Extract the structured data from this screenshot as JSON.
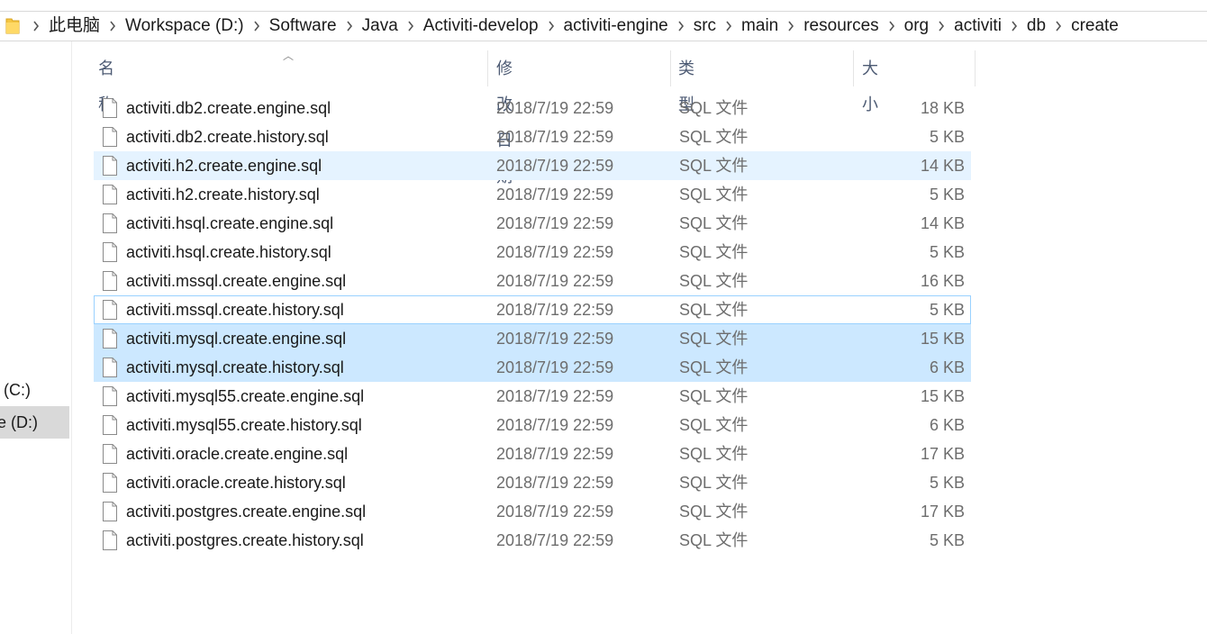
{
  "breadcrumb": [
    "此电脑",
    "Workspace (D:)",
    "Software",
    "Java",
    "Activiti-develop",
    "activiti-engine",
    "src",
    "main",
    "resources",
    "org",
    "activiti",
    "db",
    "create"
  ],
  "nav": {
    "drive_c": "(C:)",
    "drive_d": "ce (D:)"
  },
  "columns": {
    "name": "名称",
    "date": "修改日期",
    "type": "类型",
    "size": "大小"
  },
  "files": [
    {
      "name": "activiti.db2.create.engine.sql",
      "date": "2018/7/19 22:59",
      "type": "SQL 文件",
      "size": "18 KB",
      "state": ""
    },
    {
      "name": "activiti.db2.create.history.sql",
      "date": "2018/7/19 22:59",
      "type": "SQL 文件",
      "size": "5 KB",
      "state": ""
    },
    {
      "name": "activiti.h2.create.engine.sql",
      "date": "2018/7/19 22:59",
      "type": "SQL 文件",
      "size": "14 KB",
      "state": "hover"
    },
    {
      "name": "activiti.h2.create.history.sql",
      "date": "2018/7/19 22:59",
      "type": "SQL 文件",
      "size": "5 KB",
      "state": ""
    },
    {
      "name": "activiti.hsql.create.engine.sql",
      "date": "2018/7/19 22:59",
      "type": "SQL 文件",
      "size": "14 KB",
      "state": ""
    },
    {
      "name": "activiti.hsql.create.history.sql",
      "date": "2018/7/19 22:59",
      "type": "SQL 文件",
      "size": "5 KB",
      "state": ""
    },
    {
      "name": "activiti.mssql.create.engine.sql",
      "date": "2018/7/19 22:59",
      "type": "SQL 文件",
      "size": "16 KB",
      "state": ""
    },
    {
      "name": "activiti.mssql.create.history.sql",
      "date": "2018/7/19 22:59",
      "type": "SQL 文件",
      "size": "5 KB",
      "state": "focused"
    },
    {
      "name": "activiti.mysql.create.engine.sql",
      "date": "2018/7/19 22:59",
      "type": "SQL 文件",
      "size": "15 KB",
      "state": "selected"
    },
    {
      "name": "activiti.mysql.create.history.sql",
      "date": "2018/7/19 22:59",
      "type": "SQL 文件",
      "size": "6 KB",
      "state": "selected"
    },
    {
      "name": "activiti.mysql55.create.engine.sql",
      "date": "2018/7/19 22:59",
      "type": "SQL 文件",
      "size": "15 KB",
      "state": ""
    },
    {
      "name": "activiti.mysql55.create.history.sql",
      "date": "2018/7/19 22:59",
      "type": "SQL 文件",
      "size": "6 KB",
      "state": ""
    },
    {
      "name": "activiti.oracle.create.engine.sql",
      "date": "2018/7/19 22:59",
      "type": "SQL 文件",
      "size": "17 KB",
      "state": ""
    },
    {
      "name": "activiti.oracle.create.history.sql",
      "date": "2018/7/19 22:59",
      "type": "SQL 文件",
      "size": "5 KB",
      "state": ""
    },
    {
      "name": "activiti.postgres.create.engine.sql",
      "date": "2018/7/19 22:59",
      "type": "SQL 文件",
      "size": "17 KB",
      "state": ""
    },
    {
      "name": "activiti.postgres.create.history.sql",
      "date": "2018/7/19 22:59",
      "type": "SQL 文件",
      "size": "5 KB",
      "state": ""
    }
  ],
  "colors": {
    "selected": "#cce8ff",
    "hover": "#e5f3ff",
    "focus_border": "#99d1ff",
    "header_text": "#4c5a73"
  }
}
